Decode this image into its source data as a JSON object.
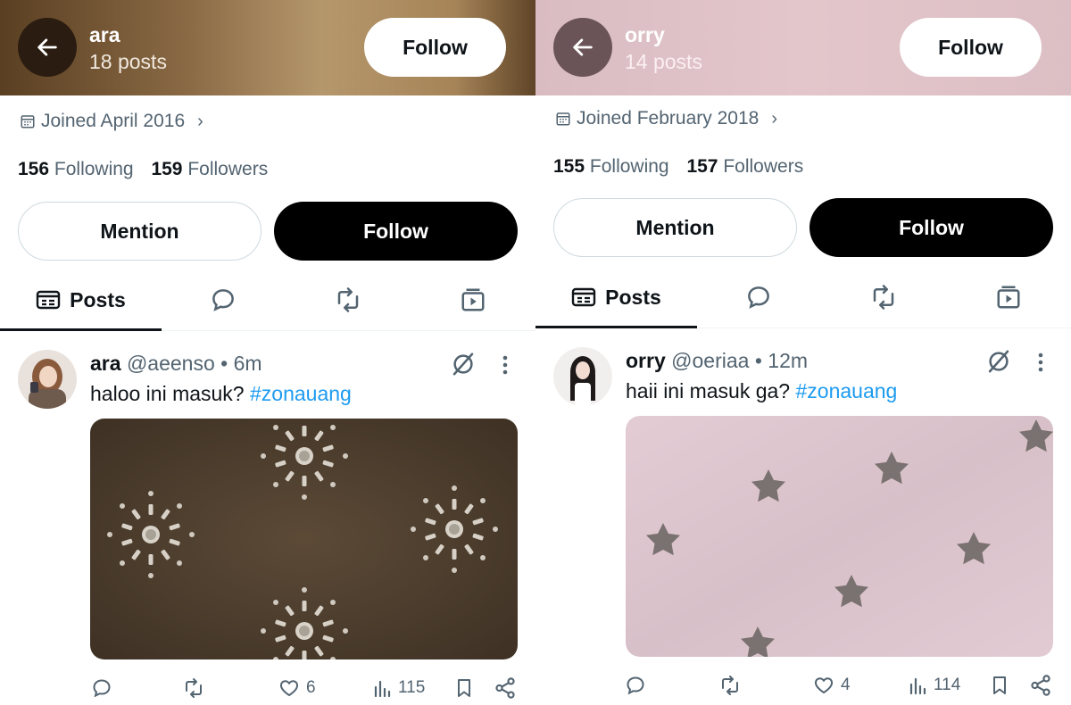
{
  "panels": [
    {
      "header": {
        "name": "ara",
        "posts": "18 posts",
        "follow": "Follow"
      },
      "joined": "Joined April 2016",
      "following_count": "156",
      "following_label": "Following",
      "followers_count": "159",
      "followers_label": "Followers",
      "mention_label": "Mention",
      "follow_label": "Follow",
      "tab_posts": "Posts",
      "post": {
        "name": "ara",
        "handle": "@aeenso",
        "time": "6m",
        "text": "haloo ini masuk?",
        "hashtag": "#zonauang",
        "likes": "6",
        "views": "115"
      },
      "colors": {
        "header_start": "#5a3f22",
        "header_mid": "#b5976c"
      }
    },
    {
      "header": {
        "name": "orry",
        "posts": "14 posts",
        "follow": "Follow"
      },
      "joined": "Joined February 2018",
      "following_count": "155",
      "following_label": "Following",
      "followers_count": "157",
      "followers_label": "Followers",
      "mention_label": "Mention",
      "follow_label": "Follow",
      "tab_posts": "Posts",
      "post": {
        "name": "orry",
        "handle": "@oeriaa",
        "time": "12m",
        "text": "haii ini masuk ga?",
        "hashtag": "#zonauang",
        "likes": "4",
        "views": "114"
      },
      "colors": {
        "header_start": "#d9bcc2",
        "header_mid": "#e3c6cb"
      }
    }
  ],
  "icons": {
    "back": "arrow-left-icon",
    "calendar": "calendar-icon",
    "posts_tab": "posts-tab-icon",
    "replies_tab": "replies-tab-icon",
    "reposts_tab": "reposts-tab-icon",
    "media_tab": "media-tab-icon",
    "grok": "grok-icon",
    "more": "more-vertical-icon",
    "reply": "reply-icon",
    "repost": "repost-icon",
    "like": "heart-icon",
    "views": "views-chart-icon",
    "bookmark": "bookmark-icon",
    "share": "share-icon"
  },
  "colors": {
    "hashtag": "#1d9bf0",
    "follow_dark": "#000000",
    "muted": "#536471"
  }
}
